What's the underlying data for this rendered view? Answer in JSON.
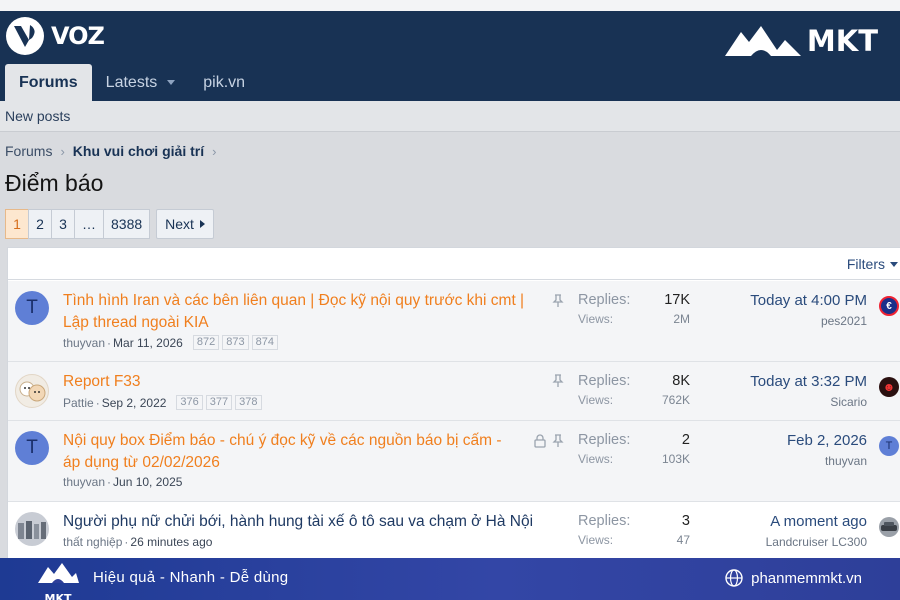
{
  "header": {
    "site_name": "VOZ",
    "brand_watermark": "MKT",
    "tabs": [
      {
        "label": "Forums",
        "active": true
      },
      {
        "label": "Latests",
        "active": false
      },
      {
        "label": "pik.vn",
        "active": false
      }
    ]
  },
  "subnav": {
    "new_posts": "New posts"
  },
  "breadcrumb": [
    "Forums",
    "Khu vui chơi giải trí"
  ],
  "page_title": "Điểm báo",
  "pagination": {
    "pages": [
      "1",
      "2",
      "3",
      "…",
      "8388"
    ],
    "current": "1",
    "next_label": "Next"
  },
  "filters_label": "Filters",
  "stat_labels": {
    "replies": "Replies:",
    "views": "Views:"
  },
  "threads": [
    {
      "title": "Tình hình Iran và các bên liên quan | Đọc kỹ nội quy trước khi cmt | Lập thread ngoài KIA",
      "author": "thuyvan",
      "date": "Mar 11, 2026",
      "mini_pages": [
        "872",
        "873",
        "874"
      ],
      "replies": "17K",
      "views": "2M",
      "last_time": "Today at 4:00 PM",
      "last_user": "pes2021",
      "avatar_letter": "T",
      "pinned": true,
      "locked": false,
      "unread": true
    },
    {
      "title": "Report F33",
      "author": "Pattie",
      "date": "Sep 2, 2022",
      "mini_pages": [
        "376",
        "377",
        "378"
      ],
      "replies": "8K",
      "views": "762K",
      "last_time": "Today at 3:32 PM",
      "last_user": "Sicario",
      "avatar_letter": "",
      "pinned": true,
      "locked": false,
      "unread": true
    },
    {
      "title": "Nội quy box Điểm báo - chú ý đọc kỹ về các nguồn báo bị cấm - áp dụng từ 02/02/2026",
      "author": "thuyvan",
      "date": "Jun 10, 2025",
      "mini_pages": [],
      "replies": "2",
      "views": "103K",
      "last_time": "Feb 2, 2026",
      "last_user": "thuyvan",
      "avatar_letter": "T",
      "pinned": true,
      "locked": true,
      "unread": true
    },
    {
      "title": "Người phụ nữ chửi bới, hành hung tài xế ô tô sau va chạm ở Hà Nội",
      "author": "thất nghiệp",
      "date": "26 minutes ago",
      "mini_pages": [],
      "replies": "3",
      "views": "47",
      "last_time": "A moment ago",
      "last_user": "Landcruiser LC300",
      "avatar_letter": "",
      "pinned": false,
      "locked": false,
      "unread": false
    }
  ],
  "footer": {
    "logo_text": "MKT",
    "slogan": "Hiệu quả - Nhanh - Dễ dùng",
    "website": "phanmemmkt.vn"
  },
  "colors": {
    "header_bg": "#183254",
    "unread_title": "#f07f1e",
    "link_blue": "#2a4b7c",
    "footer_bg": "#2e3f99"
  }
}
